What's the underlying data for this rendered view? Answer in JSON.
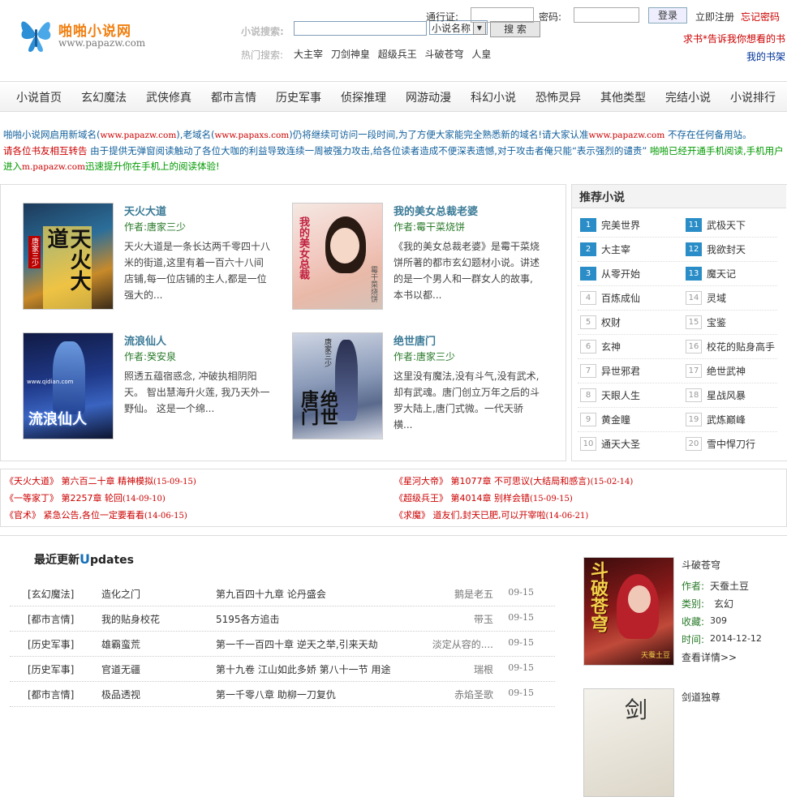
{
  "header": {
    "logo_name": "啪啪小说网",
    "logo_url": "www.papazw.com",
    "search_label": "小说搜索:",
    "search_value": "",
    "search_select": "小说名称",
    "search_button": "搜 索",
    "hot_label": "热门搜索:",
    "hot_items": [
      "大主宰",
      "刀剑神皇",
      "超级兵王",
      "斗破苍穹",
      "人皇"
    ],
    "pass_label": "通行证:",
    "pwd_label": "密码:",
    "login_button": "登录",
    "register": "立即注册",
    "forgot": "忘记密码",
    "ask_book": "求书*告诉我你想看的书",
    "my_shelf": "我的书架"
  },
  "nav": [
    "小说首页",
    "玄幻魔法",
    "武侠修真",
    "都市言情",
    "历史军事",
    "侦探推理",
    "网游动漫",
    "科幻小说",
    "恐怖灵异",
    "其他类型",
    "完结小说",
    "小说排行"
  ],
  "notice": {
    "p1a": "啪啪小说网启用新域名(",
    "p1b": "www.papazw.com",
    "p1c": "),老域名(",
    "p1d": "www.papaxs.com",
    "p1e": ")仍将继续可访问一段时间,为了方便大家能完全熟悉新的域名!请大家认准",
    "p1f": "www.papazw.com",
    "p1g": " 不存在任何备用站。",
    "p2a": "请各位书友相互转告",
    "p2b": " 由于提供无弹窗阅读触动了各位大咖的利益导致连续一周被强力攻击,给各位读者造成不便深表遗憾,对于攻击者俺只能“表示强烈的谴责” ",
    "p2c": "啪啪已经开通手机阅读,手机用户进入",
    "p2d": "m.papazw.com",
    "p2e": "迅速提升你在手机上的阅读体验!"
  },
  "featured": [
    {
      "title": "天火大道",
      "author": "作者:唐家三少",
      "desc": "天火大道是一条长达两千零四十八米的街道,这里有着一百六十八间店铺,每一位店铺的主人,都是一位强大的...",
      "cover_text": "天火大道",
      "cover_sub": "唐家三少"
    },
    {
      "title": "我的美女总裁老婆",
      "author": "作者:霉干菜烧饼",
      "desc": "《我的美女总裁老婆》是霉干菜烧饼所著的都市玄幻题材小说。讲述的是一个男人和一群女人的故事,本书以都...",
      "cover_text": "我的美女总裁",
      "cover_sub": "霉干菜烧饼"
    },
    {
      "title": "流浪仙人",
      "author": "作者:癸安泉",
      "desc": "照透五蕴宿惑念, 冲破执相阴阳天。 智出慧海升火莲, 我乃天外一野仙。 这是一个绵...",
      "cover_text": "流浪仙人",
      "cover_sub": "www.qidian.com"
    },
    {
      "title": "绝世唐门",
      "author": "作者:唐家三少",
      "desc": "这里没有魔法,没有斗气,没有武术,却有武魂。唐门创立万年之后的斗罗大陆上,唐门式微。一代天骄横...",
      "cover_text": "绝世唐门",
      "cover_sub": "唐家三少"
    }
  ],
  "recommend": {
    "title": "推荐小说",
    "left": [
      {
        "n": "1",
        "name": "完美世界"
      },
      {
        "n": "2",
        "name": "大主宰"
      },
      {
        "n": "3",
        "name": "从零开始"
      },
      {
        "n": "4",
        "name": "百炼成仙"
      },
      {
        "n": "5",
        "name": "权财"
      },
      {
        "n": "6",
        "name": "玄神"
      },
      {
        "n": "7",
        "name": "异世邪君"
      },
      {
        "n": "8",
        "name": "天眼人生"
      },
      {
        "n": "9",
        "name": "黄金瞳"
      },
      {
        "n": "10",
        "name": "通天大圣"
      }
    ],
    "right": [
      {
        "n": "11",
        "name": "武极天下"
      },
      {
        "n": "12",
        "name": "我欲封天"
      },
      {
        "n": "13",
        "name": "魔天记"
      },
      {
        "n": "14",
        "name": "灵域"
      },
      {
        "n": "15",
        "name": "宝鉴"
      },
      {
        "n": "16",
        "name": "校花的贴身高手"
      },
      {
        "n": "17",
        "name": "绝世武神"
      },
      {
        "n": "18",
        "name": "星战风暴"
      },
      {
        "n": "19",
        "name": "武炼巅峰"
      },
      {
        "n": "20",
        "name": "雪中悍刀行"
      }
    ]
  },
  "chapters": [
    {
      "book": "《天火大道》",
      "chap": " 第六百二十章 精神模拟",
      "date": "(15-09-15)"
    },
    {
      "book": "《星河大帝》",
      "chap": " 第1077章 不可思议(大结局和感言)",
      "date": "(15-02-14)"
    },
    {
      "book": "《一等家丁》",
      "chap": " 第2257章 轮回",
      "date": "(14-09-10)"
    },
    {
      "book": "《超级兵王》",
      "chap": " 第4014章 别样会错",
      "date": "(15-09-15)"
    },
    {
      "book": "《官术》",
      "chap": " 紧急公告,各位一定要看看",
      "date": "(14-06-15)"
    },
    {
      "book": "《求魔》",
      "chap": " 道友们,封天已肥,可以开宰啦",
      "date": "(14-06-21)"
    }
  ],
  "updates": {
    "title_a": "最近更新",
    "title_u": "U",
    "title_b": "pdates",
    "rows": [
      {
        "cat": "[玄幻魔法]",
        "book": "造化之门",
        "chap": "第九百四十九章 论丹盛会",
        "author": "鹅是老五",
        "date": "09-15"
      },
      {
        "cat": "[都市言情]",
        "book": "我的贴身校花",
        "chap": "5195各方追击",
        "author": "带玉",
        "date": "09-15"
      },
      {
        "cat": "[历史军事]",
        "book": "雄霸蛮荒",
        "chap": "第一千一百四十章 逆天之举,引来天劫",
        "author": "淡定从容的....",
        "date": "09-15"
      },
      {
        "cat": "[历史军事]",
        "book": "官道无疆",
        "chap": "第十九卷 江山如此多娇 第八十一节 用途",
        "author": "瑞根",
        "date": "09-15"
      },
      {
        "cat": "[都市言情]",
        "book": "极品透视",
        "chap": "第一千零八章 助柳一刀复仇",
        "author": "赤焰圣歌",
        "date": "09-15"
      }
    ]
  },
  "side_books": [
    {
      "title": "斗破苍穹",
      "author_k": "作者:",
      "author_v": "天蚕土豆",
      "cat_k": "类别:",
      "cat_v": "玄幻",
      "fav_k": "收藏:",
      "fav_v": "309",
      "time_k": "时间:",
      "time_v": "2014-12-12",
      "more": "查看详情>>",
      "cover_text": "斗破苍穹",
      "cover_sub": "天蚕土豆"
    },
    {
      "title": "剑道独尊",
      "cover_text": "剑"
    }
  ]
}
